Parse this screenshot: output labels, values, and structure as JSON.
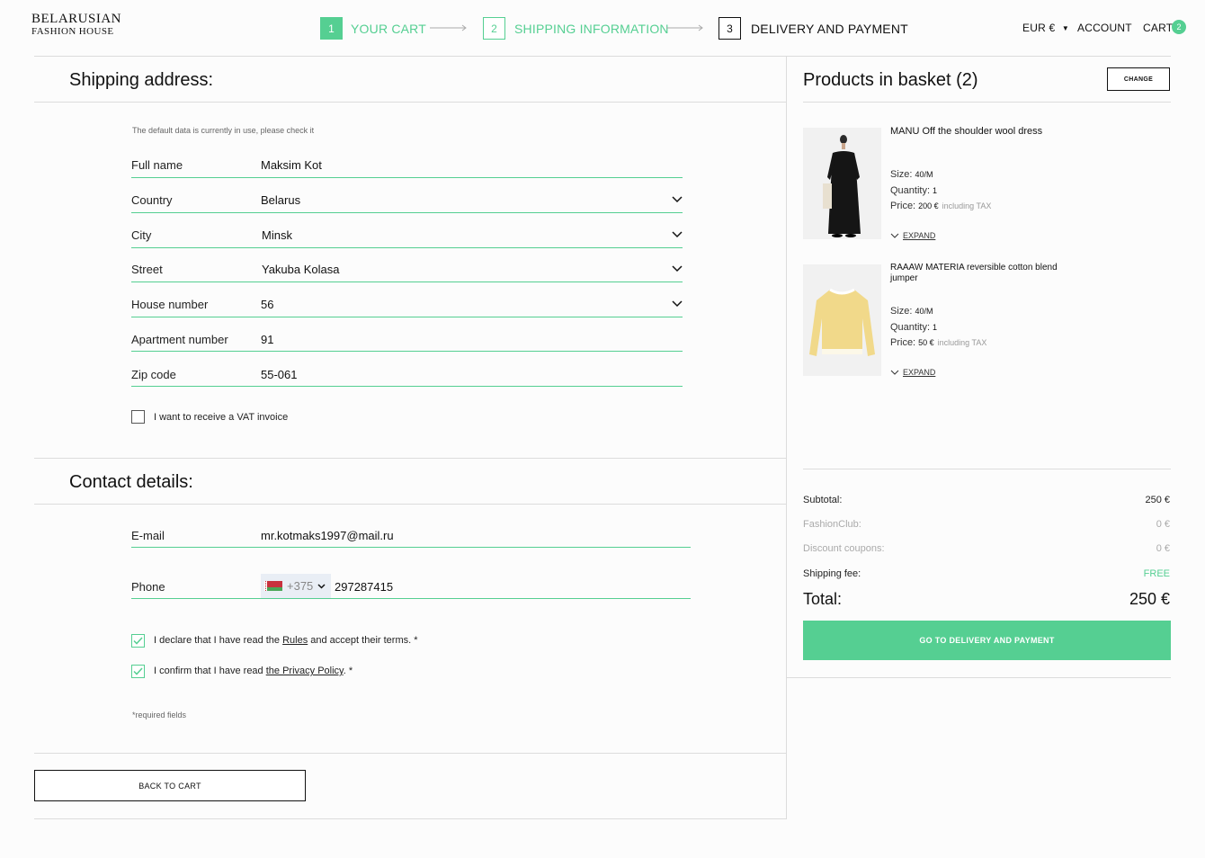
{
  "header": {
    "logo_line1": "BELARUSIAN",
    "logo_line2": "FASHION HOUSE",
    "steps": [
      {
        "num": "1",
        "label": "YOUR CART"
      },
      {
        "num": "2",
        "label": "SHIPPING INFORMATION"
      },
      {
        "num": "3",
        "label": "DELIVERY AND PAYMENT"
      }
    ],
    "currency": "EUR €",
    "account": "ACCOUNT",
    "cart": "CART",
    "cart_count": "2"
  },
  "shipping": {
    "title": "Shipping address:",
    "note": "The default data is currently in use, please check it",
    "fields": [
      {
        "label": "Full name",
        "value": "Maksim Kot"
      },
      {
        "label": "Country",
        "value": "Belarus"
      },
      {
        "label": "City",
        "value": "Minsk"
      },
      {
        "label": "Street",
        "value": "Yakuba Kolasa"
      },
      {
        "label": "House number",
        "value": "56"
      },
      {
        "label": "Apartment number",
        "value": "91"
      },
      {
        "label": "Zip code",
        "value": "55-061"
      }
    ],
    "vat_label": "I want to receive a VAT invoice"
  },
  "contact": {
    "title": "Contact details:",
    "email_label": "E-mail",
    "email_value": "mr.kotmaks1997@mail.ru",
    "phone_label": "Phone",
    "phone_code": "+375",
    "phone_value": "297287415",
    "rules_pre": "I declare that I have read the ",
    "rules_link": "Rules",
    "rules_post": " and accept their terms. *",
    "privacy_pre": "I confirm that I have read ",
    "privacy_link": "the Privacy Policy",
    "privacy_post": ". *",
    "required_note": "*required fields",
    "back_button": "BACK TO CART"
  },
  "basket": {
    "title": "Products in basket (2)",
    "change_button": "CHANGE",
    "products": [
      {
        "name": "MANU Off the shoulder wool dress",
        "size_label": "Size:",
        "size": "40/M",
        "qty_label": "Quantity:",
        "qty": "1",
        "price_label": "Price:",
        "price": "200 €",
        "tax": "including TAX",
        "expand": "EXPAND"
      },
      {
        "name": "RAAAW MATERIA reversible cotton blend jumper",
        "size_label": "Size:",
        "size": "40/M",
        "qty_label": "Quantity:",
        "qty": "1",
        "price_label": "Price:",
        "price": "50 €",
        "tax": "including TAX",
        "expand": "EXPAND"
      }
    ],
    "summary": {
      "subtotal_label": "Subtotal:",
      "subtotal": "250 €",
      "club_label": "FashionClub:",
      "club": "0 €",
      "coupons_label": "Discount coupons:",
      "coupons": "0 €",
      "shipping_label": "Shipping fee:",
      "shipping": "FREE",
      "total_label": "Total:",
      "total": "250 €"
    },
    "checkout_button": "GO TO DELIVERY AND PAYMENT"
  },
  "colors": {
    "accent": "#55cf92"
  },
  "icons": [
    "chevron-down-icon",
    "arrow-right-icon",
    "check-icon",
    "caret-down-icon",
    "belarus-flag-icon"
  ]
}
